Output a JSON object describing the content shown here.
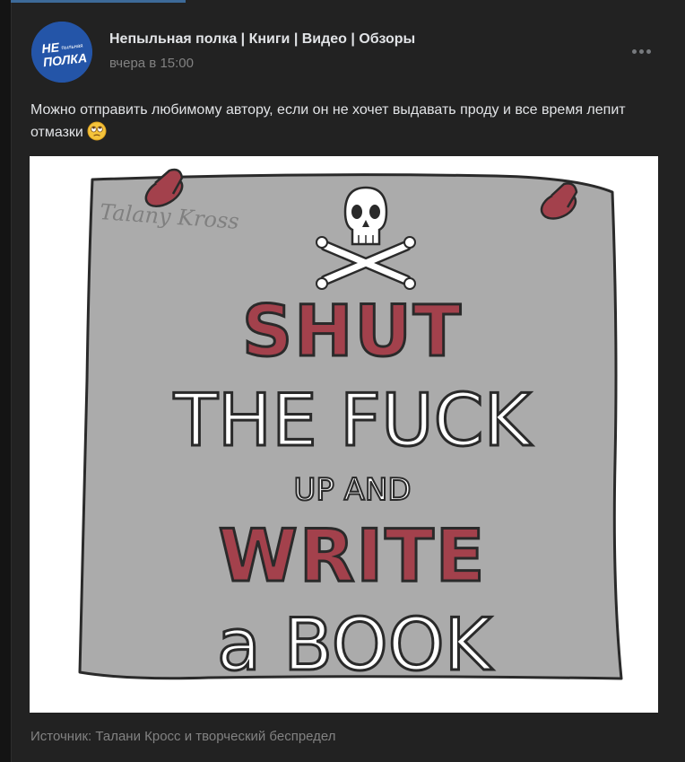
{
  "author": {
    "name": "Непыльная полка | Книги | Видео | Обзоры",
    "avatar_line1": "НЕ",
    "avatar_line1_small": "пыльная",
    "avatar_line2": "ПОЛКА"
  },
  "post": {
    "time": "вчера в 15:00",
    "text": "Можно отправить любимому автору, если он не хочет выдавать проду и все время лепит отмазки",
    "emoji_icon": "rolling-eyes-emoji-icon",
    "source": "Источник: Талани Кросс и творческий беспредел"
  },
  "image": {
    "signature": "Talany Kross",
    "line_shut": "SHUT",
    "line_the_fuck": "THE FUCK",
    "line_up_and": "UP AND",
    "line_write": "WRITE",
    "line_a_book": "a BOOK",
    "icons": [
      "skull-crossbones-icon",
      "push-pin-icon"
    ]
  },
  "colors": {
    "background": "#141414",
    "card": "#222222",
    "accent": "#3d6a99",
    "text_primary": "#e1e3e6",
    "text_secondary": "#828282",
    "poster_gray": "#ababab",
    "poster_red": "#a3414c"
  }
}
